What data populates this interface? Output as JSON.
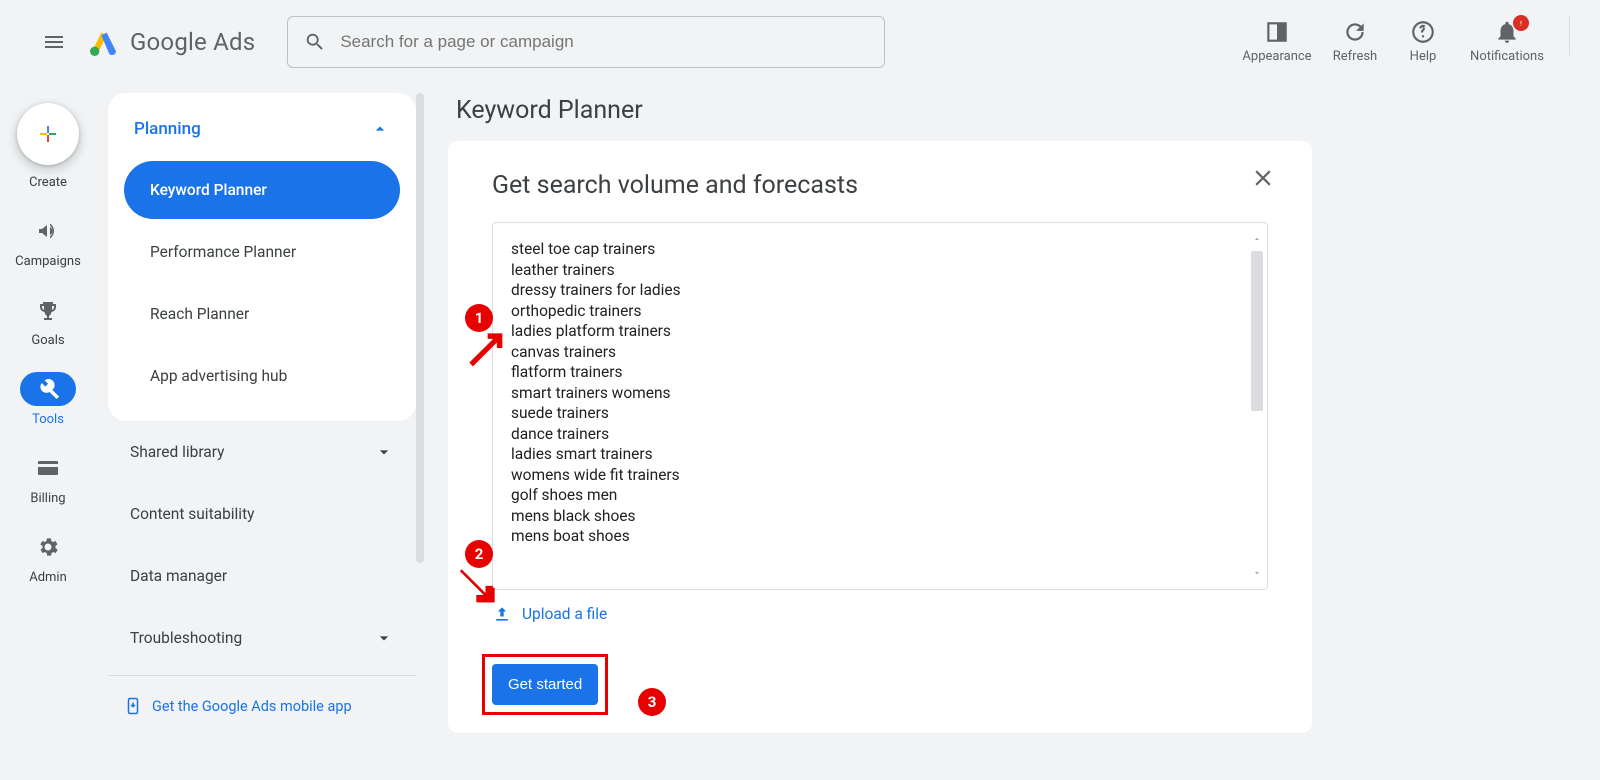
{
  "header": {
    "brand_text_1": "Google",
    "brand_text_2": " Ads",
    "search_placeholder": "Search for a page or campaign",
    "actions": {
      "appearance": "Appearance",
      "refresh": "Refresh",
      "help": "Help",
      "notifications": "Notifications"
    }
  },
  "rail": {
    "create": "Create",
    "campaigns": "Campaigns",
    "goals": "Goals",
    "tools": "Tools",
    "billing": "Billing",
    "admin": "Admin"
  },
  "sidepanel": {
    "planning": "Planning",
    "items": {
      "keyword_planner": "Keyword Planner",
      "performance_planner": "Performance Planner",
      "reach_planner": "Reach Planner",
      "app_adv_hub": "App advertising hub"
    },
    "shared_library": "Shared library",
    "content_suitability": "Content suitability",
    "data_manager": "Data manager",
    "troubleshooting": "Troubleshooting",
    "mobile_app": "Get the Google Ads mobile app"
  },
  "main": {
    "page_title": "Keyword Planner",
    "card_title": "Get search volume and forecasts",
    "keywords_text": "steel toe cap trainers\nleather trainers\ndressy trainers for ladies\northopedic trainers\nladies platform trainers\ncanvas trainers\nflatform trainers\nsmart trainers womens\nsuede trainers\ndance trainers\nladies smart trainers\nwomens wide fit trainers\ngolf shoes men\nmens black shoes\nmens boat shoes",
    "upload_label": "Upload a file",
    "cta": "Get started"
  },
  "annotations": {
    "n1": "1",
    "n2": "2",
    "n3": "3"
  }
}
